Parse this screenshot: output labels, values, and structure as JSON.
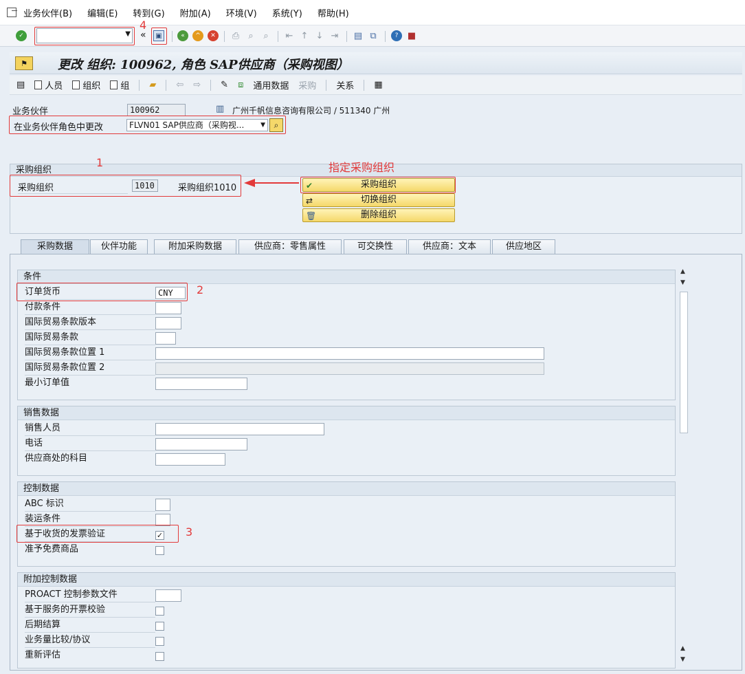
{
  "menu": {
    "items": [
      "业务伙伴(B)",
      "编辑(E)",
      "转到(G)",
      "附加(A)",
      "环境(V)",
      "系统(Y)",
      "帮助(H)"
    ]
  },
  "toolbar": {
    "chevron": "«",
    "annotation_4": "4"
  },
  "title": "更改 组织: 100962, 角色 SAP供应商（采购视图）",
  "app_toolbar": {
    "person": "人员",
    "organization": "组织",
    "group": "组",
    "general_data": "通用数据",
    "purchasing": "采购",
    "relationships": "关系"
  },
  "header": {
    "bp_label": "业务伙伴",
    "bp_value": "100962",
    "bp_desc": "广州千帆信息咨询有限公司 / 511340 广州",
    "role_label": "在业务伙伴角色中更改",
    "role_value": "FLVN01 SAP供应商（采购视..."
  },
  "purchasing_org": {
    "group_title": "采购组织",
    "label": "采购组织",
    "value": "1010",
    "desc": "采购组织1010",
    "annotation_1": "1",
    "annotation_text": "指定采购组织",
    "btn_select": "采购组织",
    "btn_switch": "切换组织",
    "btn_delete": "删除组织"
  },
  "tabs": [
    "采购数据",
    "伙伴功能",
    "附加采购数据",
    "供应商：零售属性",
    "可交换性",
    "供应商：文本",
    "供应地区"
  ],
  "conditions": {
    "title": "条件",
    "order_currency_label": "订单货币",
    "order_currency_value": "CNY",
    "annotation_2": "2",
    "payment_terms": "付款条件",
    "incoterms_version": "国际贸易条款版本",
    "incoterms": "国际贸易条款",
    "incoterms_loc1": "国际贸易条款位置 1",
    "incoterms_loc2": "国际贸易条款位置 2",
    "min_order_value": "最小订单值"
  },
  "sales": {
    "title": "销售数据",
    "salesperson": "销售人员",
    "phone": "电话",
    "account_at_vendor": "供应商处的科目"
  },
  "control": {
    "title": "控制数据",
    "abc": "ABC 标识",
    "shipping": "装运条件",
    "gr_based_iv": "基于收货的发票验证",
    "gr_based_iv_checked": "✓",
    "annotation_3": "3",
    "free_goods": "准予免费商品"
  },
  "add_control": {
    "title": "附加控制数据",
    "proact": "PROACT 控制参数文件",
    "service_based": "基于服务的开票校验",
    "subsequent_settlement": "后期结算",
    "volume_comparison": "业务量比较/协议",
    "revaluation": "重新评估"
  },
  "colors": {
    "annotation_red": "#e23a3a",
    "button_yellow": "#f5d86a",
    "panel_blue": "#e8eef5"
  }
}
